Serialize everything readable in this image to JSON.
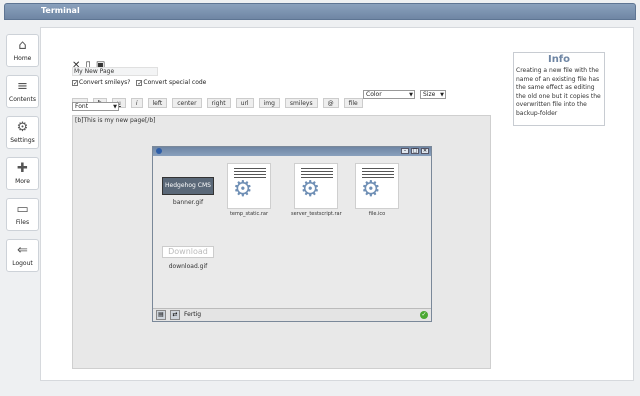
{
  "window": {
    "title": "Terminal"
  },
  "sidebar": {
    "items": [
      {
        "label": "Home",
        "icon": "home-icon",
        "glyph": "⌂"
      },
      {
        "label": "Contents",
        "icon": "document-icon",
        "glyph": "≡"
      },
      {
        "label": "Settings",
        "icon": "gear-icon",
        "glyph": "⚙"
      },
      {
        "label": "More",
        "icon": "plus-icon",
        "glyph": "✚"
      },
      {
        "label": "Files",
        "icon": "folder-icon",
        "glyph": "▭"
      },
      {
        "label": "Logout",
        "icon": "logout-arrow-icon",
        "glyph": "⇐"
      }
    ]
  },
  "editor": {
    "page_name": "My New Page",
    "checkbox_smileys": "Convert smileys?",
    "checkbox_special": "Convert special code",
    "format_buttons": [
      "...",
      "b",
      "u",
      "i",
      "left",
      "center",
      "right",
      "url",
      "img",
      "smileys",
      "@",
      "file"
    ],
    "color_select": "Color",
    "size_select": "Size",
    "font_select": "Font",
    "content": "[b]This is my new page[/b]"
  },
  "file_window": {
    "files": [
      "temp_static.rar",
      "server_testscript.rar",
      "file.ico"
    ],
    "banner_text": "Hedgehog CMS",
    "banner_caption": "banner.gif",
    "download_text": "Download",
    "download_caption": "download.gif",
    "status_text": "Fertig",
    "min_glyph": "–",
    "max_glyph": "□",
    "close_glyph": "✕",
    "ok_glyph": "✓"
  },
  "info": {
    "title": "Info",
    "text": "Creating a new file with the name of an existing file has the same effect as editing the old one but it copies the overwritten file into the backup-folder"
  },
  "colors": {
    "titlebar": "#7a91ae",
    "accent": "#6f86a4"
  }
}
